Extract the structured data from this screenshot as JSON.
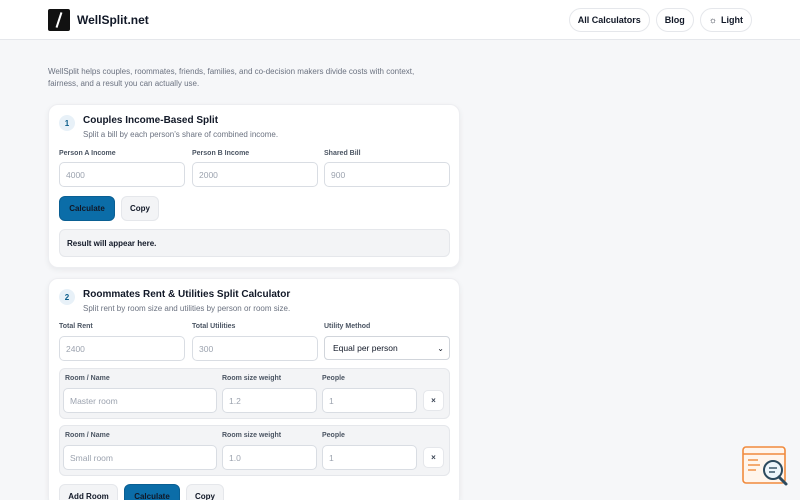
{
  "brand": {
    "name": "WellSplit.net"
  },
  "nav": [
    {
      "label": "All Calculators"
    },
    {
      "label": "Blog"
    },
    {
      "label": "Light",
      "icon": "sun-icon"
    }
  ],
  "intro": "WellSplit helps couples, roommates, friends, families, and co-decision makers divide costs with context, fairness, and a result you can actually use.",
  "couples": {
    "step": "1",
    "title": "Couples Income-Based Split",
    "description": "Split a bill by each person’s share of combined income.",
    "fields": [
      {
        "label": "Person A Income",
        "placeholder": "4000"
      },
      {
        "label": "Person B Income",
        "placeholder": "2000"
      },
      {
        "label": "Shared Bill",
        "placeholder": "900"
      }
    ],
    "calculate_label": "Calculate",
    "copy_label": "Copy",
    "result": "Result will appear here."
  },
  "roommates": {
    "step": "2",
    "title": "Roommates Rent & Utilities Split Calculator",
    "description": "Split rent by room size and utilities by person or room size.",
    "total_rent": {
      "label": "Total Rent",
      "placeholder": "2400"
    },
    "total_utilities": {
      "label": "Total Utilities",
      "placeholder": "300"
    },
    "utility_method": {
      "label": "Utility Method",
      "value": "Equal per person"
    },
    "room_headers": {
      "name": "Room / Name",
      "weight": "Room size weight",
      "people": "People"
    },
    "rooms": [
      {
        "name_placeholder": "Master room",
        "weight_placeholder": "1.2",
        "people_placeholder": "1",
        "remove_label": "×"
      },
      {
        "name_placeholder": "Small room",
        "weight_placeholder": "1.0",
        "people_placeholder": "1",
        "remove_label": "×"
      }
    ],
    "add_room_label": "Add Room",
    "calculate_label": "Calculate",
    "copy_label": "Copy"
  },
  "colors": {
    "primary": "#0b6da8",
    "accent_widget": "#f08a3c",
    "background": "#f6f7f9"
  }
}
